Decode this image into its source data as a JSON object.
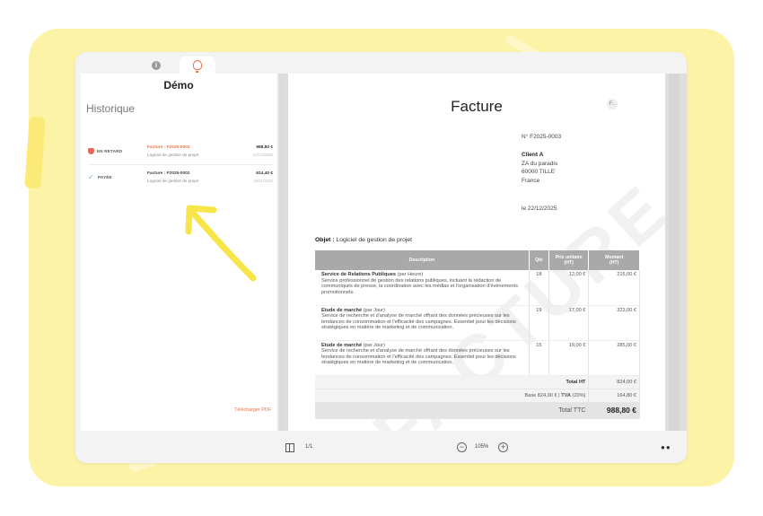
{
  "app": {
    "tabs": [
      {
        "icon": "info-icon",
        "active": false
      },
      {
        "icon": "lightbulb-icon",
        "active": true
      }
    ],
    "sidebar": {
      "title": "Démo",
      "section": "Historique",
      "items": [
        {
          "status": "EN RETARD",
          "name": "Facture : F2025-0003",
          "subtitle": "Logiciel de gestion de projet",
          "amount": "988,80 €",
          "date": "22/12/2025"
        },
        {
          "status": "PAYÉE",
          "name": "Facture : F2025-0002",
          "subtitle": "Logiciel de gestion de projet",
          "amount": "614,40 €",
          "date": "22/11/2025"
        }
      ],
      "download": "Télécharger PDF"
    },
    "document": {
      "title": "Facture",
      "logo": "F..",
      "watermark": "FACTURE",
      "number": "N° F2025-0003",
      "client": {
        "name": "Client A",
        "line1": "ZA du paradis",
        "line2": "60000 TILLE",
        "line3": "France"
      },
      "date": "le 22/12/2025",
      "objet_label": "Objet :",
      "objet_value": "Logiciel de gestion de projet",
      "table": {
        "headers": {
          "description": "Description",
          "qty": "Qté",
          "unit": "Prix unitaire",
          "unit_sub": "(HT)",
          "amount": "Montant",
          "amount_sub": "(HT)"
        },
        "rows": [
          {
            "service": "Service de Relations Publiques",
            "unit_label": "(par Heure)",
            "text": "Service professionnel de gestion des relations publiques, incluant la rédaction de communiqués de presse, la coordination avec les médias et l'organisation d'événements promotionnels.",
            "qty": "18",
            "price": "12,00 €",
            "total": "216,00 €"
          },
          {
            "service": "Etude de marché",
            "unit_label": "(par Jour)",
            "text": "Service de recherche et d'analyse de marché offrant des données précieuses sur les tendances de consommation et l'efficacité des campagnes. Essentiel pour les décisions stratégiques en matière de marketing et de communication.",
            "qty": "19",
            "price": "17,00 €",
            "total": "323,00 €"
          },
          {
            "service": "Etude de marché",
            "unit_label": "(par Jour)",
            "text": "Service de recherche et d'analyse de marché offrant des données précieuses sur les tendances de consommation et l'efficacité des campagnes. Essentiel pour les décisions stratégiques en matière de marketing et de communication.",
            "qty": "15",
            "price": "19,00 €",
            "total": "285,00 €"
          }
        ],
        "total_ht_label": "Total HT",
        "total_ht": "824,00 €",
        "tva_base": "Base 824,00 € |",
        "tva_label": "TVA",
        "tva_rate": "(20%)",
        "tva_value": "164,80 €",
        "ttc_label": "Total TTC",
        "ttc_value": "988,80 €"
      }
    },
    "bottombar": {
      "pages": "1/1",
      "zoom": "105%"
    }
  },
  "colors": {
    "accent": "#e8724a",
    "background_blob": "#fdf3a6",
    "paid": "#7cc47d",
    "late": "#e36a57",
    "arrow": "#f7e54a"
  }
}
